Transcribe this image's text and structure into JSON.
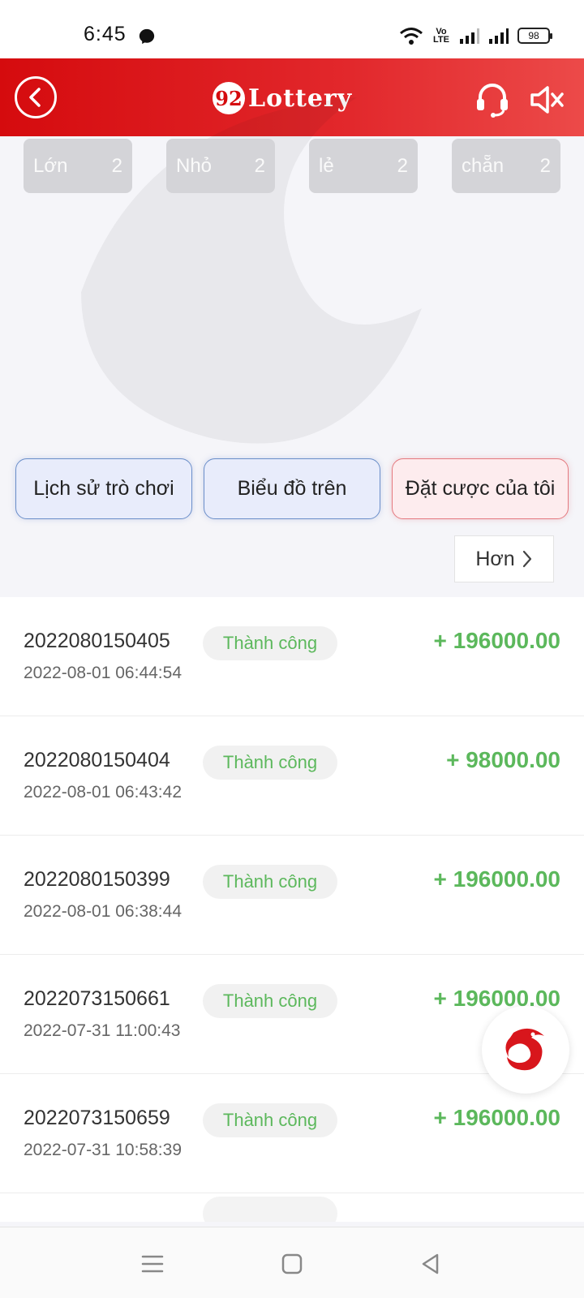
{
  "status_bar": {
    "time": "6:45",
    "volte": "Vo LTE",
    "battery": "98",
    "icons": [
      "messenger-icon",
      "wifi-icon",
      "signal-icon",
      "battery-icon"
    ]
  },
  "header": {
    "logo_badge": "92",
    "logo_text": "Lottery",
    "icons": [
      "back-icon",
      "headset-icon",
      "sound-off-icon"
    ]
  },
  "counts": [
    {
      "label": "Lớn",
      "value": "2"
    },
    {
      "label": "Nhỏ",
      "value": "2"
    },
    {
      "label": "lẻ",
      "value": "2"
    },
    {
      "label": "chẵn",
      "value": "2"
    }
  ],
  "tabs": [
    {
      "label": "Lịch sử trò chơi"
    },
    {
      "label": "Biểu đồ trên"
    },
    {
      "label": "Đặt cược của tôi"
    }
  ],
  "more": {
    "label": "Hơn"
  },
  "records": [
    {
      "id": "2022080150405",
      "status": "Thành công",
      "time": "2022-08-01 06:44:54",
      "amount": "+ 196000.00"
    },
    {
      "id": "2022080150404",
      "status": "Thành công",
      "time": "2022-08-01 06:43:42",
      "amount": "+ 98000.00"
    },
    {
      "id": "2022080150399",
      "status": "Thành công",
      "time": "2022-08-01 06:38:44",
      "amount": "+ 196000.00"
    },
    {
      "id": "2022073150661",
      "status": "Thành công",
      "time": "2022-07-31 11:00:43",
      "amount": "+ 196000.00"
    },
    {
      "id": "2022073150659",
      "status": "Thành công",
      "time": "2022-07-31 10:58:39",
      "amount": "+ 196000.00"
    },
    {
      "id": "",
      "status": "",
      "time": "",
      "amount": ""
    }
  ],
  "colors": {
    "header_red": "#d50b0e",
    "success_green": "#5cb85c",
    "chip_gray": "#d4d4d8"
  },
  "nav": [
    "menu-icon",
    "home-icon",
    "back-nav-icon"
  ]
}
